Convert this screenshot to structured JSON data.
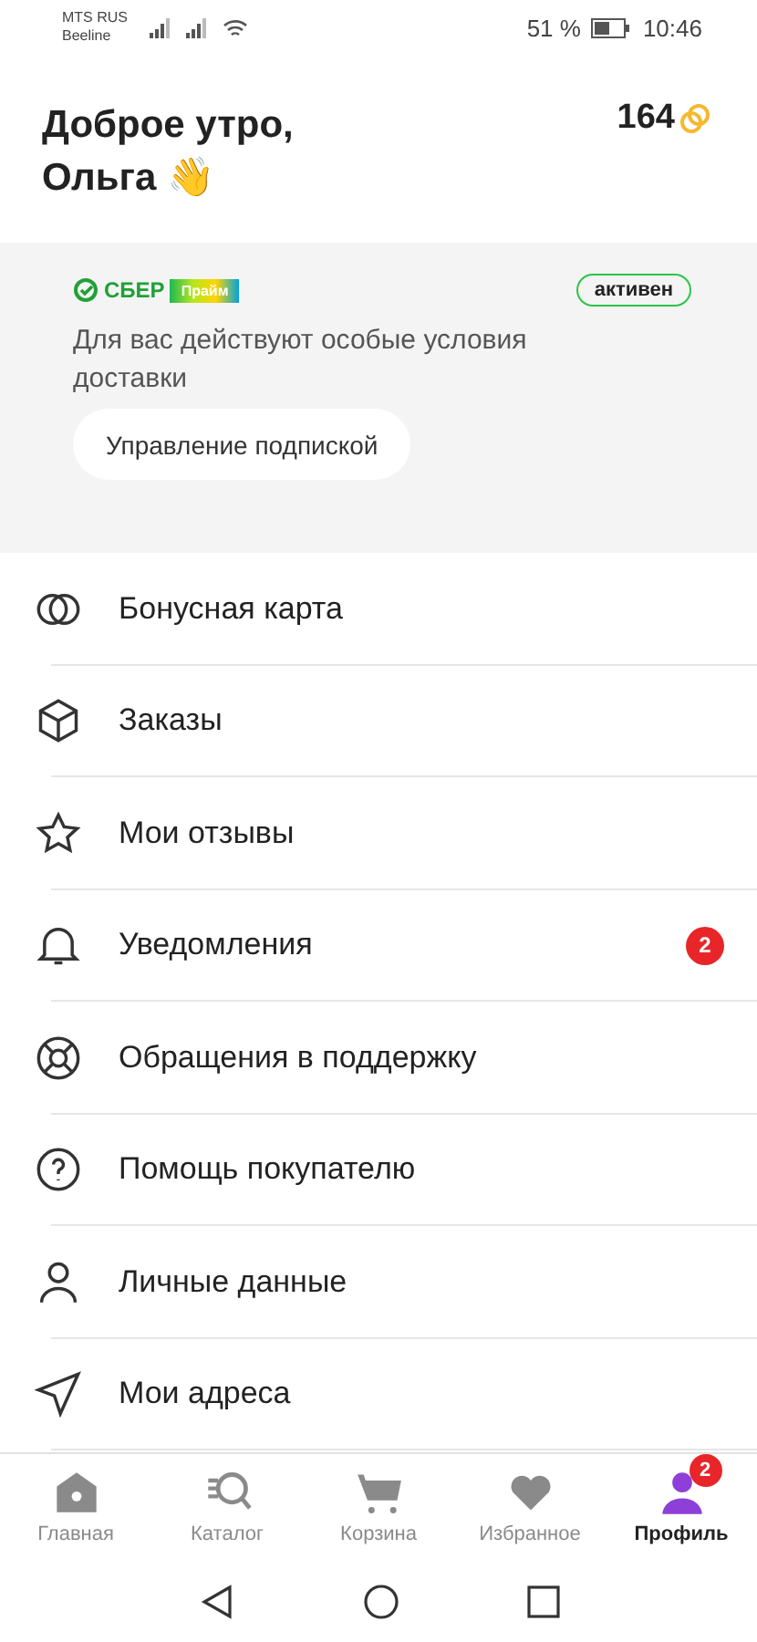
{
  "status_bar": {
    "carrier_1": "MTS RUS",
    "carrier_2": "Beeline",
    "battery": "51 %",
    "time": "10:46"
  },
  "greeting": {
    "line_1": "Доброе утро,",
    "line_2": "Ольга 👋",
    "bonus": "164"
  },
  "subscription": {
    "brand": "СБЕР",
    "brand_tag": "Прайм",
    "status": "активен",
    "active": true,
    "text": "Для вас действуют особые условия доставки",
    "button": "Управление подпиской"
  },
  "menu": [
    {
      "label": "Бонусная карта"
    },
    {
      "label": "Заказы"
    },
    {
      "label": "Мои отзывы"
    },
    {
      "label": "Уведомления",
      "badge": "2"
    },
    {
      "label": "Обращения в поддержку"
    },
    {
      "label": "Помощь покупателю"
    },
    {
      "label": "Личные данные"
    },
    {
      "label": "Мои адреса"
    }
  ],
  "tabs": [
    {
      "label": "Главная",
      "selected": false
    },
    {
      "label": "Каталог",
      "selected": false
    },
    {
      "label": "Корзина",
      "selected": false
    },
    {
      "label": "Избранное",
      "selected": false
    },
    {
      "label": "Профиль",
      "selected": true,
      "badge": "2"
    }
  ]
}
